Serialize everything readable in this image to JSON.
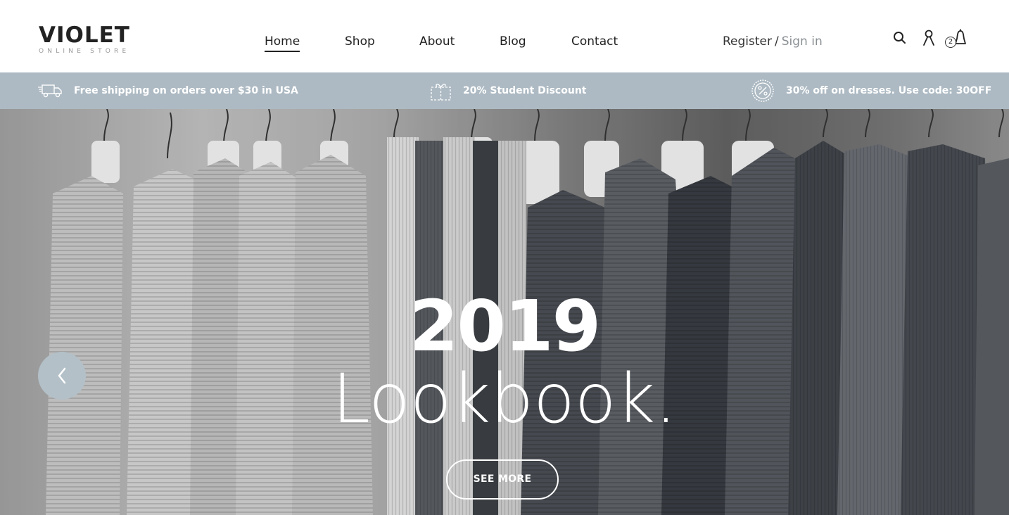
{
  "logo": {
    "title": "VIOLET",
    "subtitle": "ONLINE STORE"
  },
  "nav": {
    "items": [
      {
        "label": "Home",
        "active": true
      },
      {
        "label": "Shop",
        "active": false
      },
      {
        "label": "About",
        "active": false
      },
      {
        "label": "Blog",
        "active": false
      },
      {
        "label": "Contact",
        "active": false
      }
    ]
  },
  "auth": {
    "register": "Register",
    "separator": "/",
    "signin": "Sign in"
  },
  "header_icons": {
    "search": "search-icon",
    "account": "user-icon",
    "cart": "shopping-bag-icon",
    "cart_count": "2"
  },
  "promo": {
    "items": [
      {
        "icon": "delivery-truck-icon",
        "text": "Free shipping on orders over $30 in USA"
      },
      {
        "icon": "gift-icon",
        "text": "20% Student Discount"
      },
      {
        "icon": "percent-badge-icon",
        "text": "30% off on dresses. Use code: 30OFF"
      }
    ]
  },
  "hero": {
    "year": "2019",
    "title": "Lookbook.",
    "button": "SEE MORE",
    "prev_icon": "chevron-left-icon"
  },
  "colors": {
    "promo_bar": "#adbac3",
    "prev_button": "#b3c0c8",
    "text_dark": "#222222",
    "signin_gray": "#8a8f94"
  }
}
